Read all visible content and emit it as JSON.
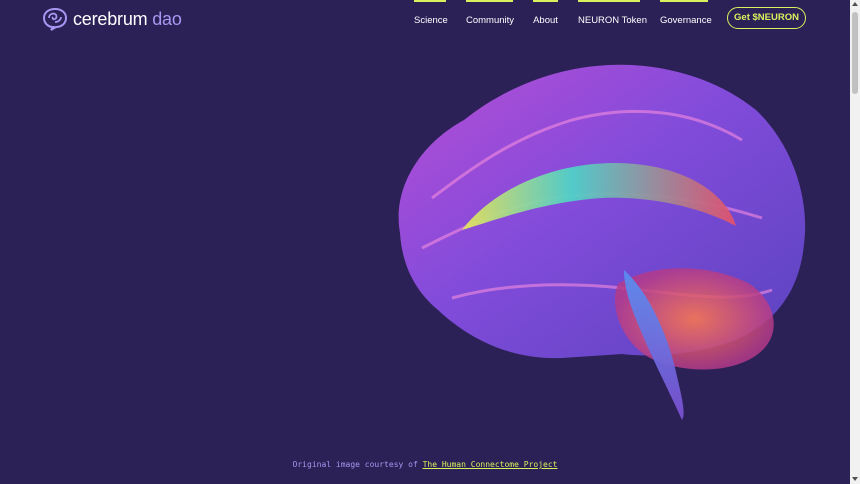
{
  "logo": {
    "word1": "cerebrum",
    "word2": "dao"
  },
  "nav": {
    "items": [
      "Science",
      "Community",
      "About",
      "NEURON Token",
      "Governance"
    ],
    "cta": "Get $NEURON"
  },
  "credit": {
    "prefix": "Original image courtesy of ",
    "link": "The Human Connectome Project"
  },
  "colors": {
    "background": "#2b2156",
    "accent": "#d8f25e",
    "brand": "#a797f2"
  },
  "icons": {
    "logo": "brain-swirl-icon"
  }
}
